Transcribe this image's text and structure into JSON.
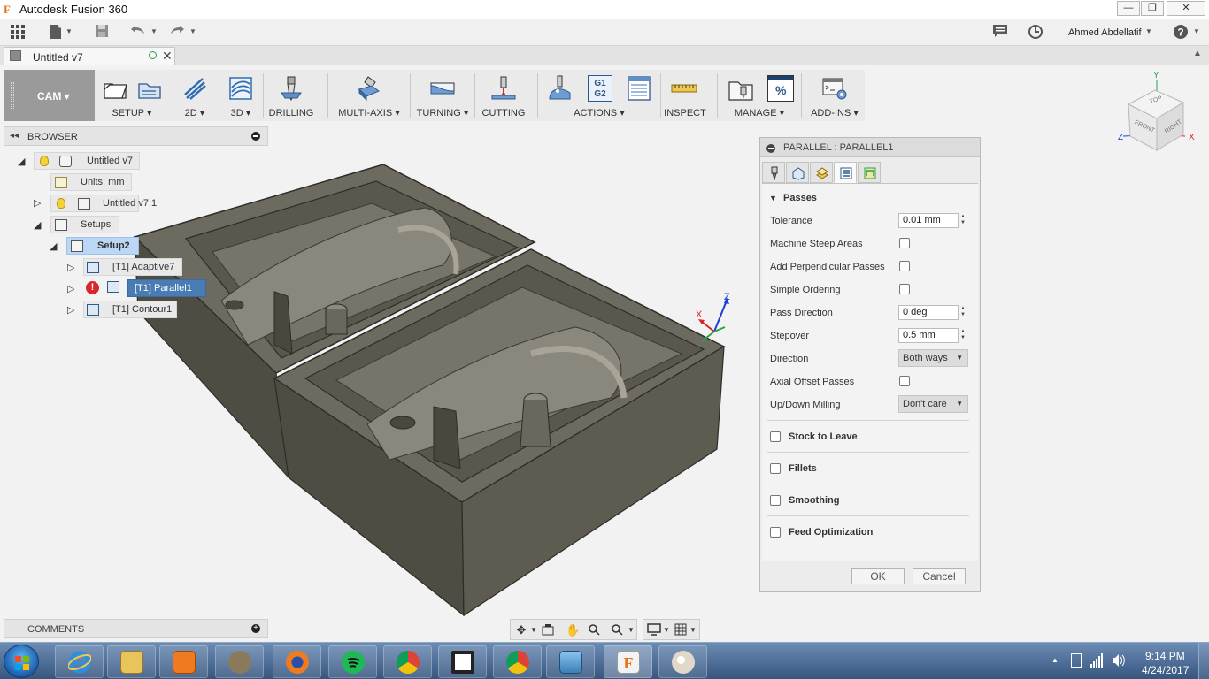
{
  "window": {
    "title": "Autodesk Fusion 360",
    "logo_letter": "F",
    "minimize": "—",
    "maximize": "❐",
    "close": "✕"
  },
  "quick_access": {
    "user_name": "Ahmed Abdellatif",
    "user_caret": "▼",
    "help_caret": "▼"
  },
  "document_tab": {
    "label": "Untitled v7",
    "close": "✕",
    "scroll_up": "▲"
  },
  "ribbon": {
    "workspace": "CAM ▾",
    "groups": [
      {
        "label": "SETUP ▾"
      },
      {
        "label": "2D ▾"
      },
      {
        "label": "3D ▾"
      },
      {
        "label": "DRILLING"
      },
      {
        "label": "MULTI-AXIS ▾"
      },
      {
        "label": "TURNING ▾"
      },
      {
        "label": "CUTTING"
      },
      {
        "label": "ACTIONS ▾"
      },
      {
        "label": "INSPECT"
      },
      {
        "label": "MANAGE ▾"
      },
      {
        "label": "ADD-INS ▾"
      }
    ],
    "gcode_line1": "G1",
    "gcode_line2": "G2",
    "percent": "%"
  },
  "browser": {
    "title": "BROWSER",
    "arrows": "◂◂",
    "nodes": {
      "root": "Untitled v7",
      "units": "Units: mm",
      "component": "Untitled v7:1",
      "setups": "Setups",
      "setup2": "Setup2",
      "adaptive": "[T1] Adaptive7",
      "parallel": "[T1] Parallel1",
      "contour": "[T1] Contour1"
    },
    "toggle_expanded": "◢",
    "toggle_collapsed": "▷",
    "error_mark": "!"
  },
  "comments": {
    "title": "COMMENTS",
    "plus": "+"
  },
  "viewcube": {
    "top": "TOP",
    "front": "FRONT",
    "right": "RIGHT",
    "axis_y": "Y",
    "axis_z": "Z",
    "axis_x": "X"
  },
  "triad": {
    "x": "X",
    "z": "Z"
  },
  "dialog": {
    "title": "PARALLEL : PARALLEL1",
    "passes_section": "Passes",
    "collapse_arrow": "▼",
    "fields": {
      "tolerance_label": "Tolerance",
      "tolerance_value": "0.01 mm",
      "steep_label": "Machine Steep Areas",
      "perp_label": "Add Perpendicular Passes",
      "ordering_label": "Simple Ordering",
      "pass_dir_label": "Pass Direction",
      "pass_dir_value": "0 deg",
      "stepover_label": "Stepover",
      "stepover_value": "0.5 mm",
      "direction_label": "Direction",
      "direction_value": "Both ways",
      "axial_label": "Axial Offset Passes",
      "updown_label": "Up/Down Milling",
      "updown_value": "Don't care"
    },
    "spinner": "▲\n▼",
    "caret": "▼",
    "sections": {
      "stock": "Stock to Leave",
      "fillets": "Fillets",
      "smoothing": "Smoothing",
      "feed": "Feed Optimization"
    },
    "ok": "OK",
    "cancel": "Cancel"
  },
  "taskbar": {
    "time": "9:14 PM",
    "date": "4/24/2017",
    "tray_arrow": "▲"
  },
  "colors": {
    "model_top": "#6a675c",
    "model_side": "#4f4c43",
    "selection": "#4a7cb4",
    "highlight": "#bcd7f5",
    "error": "#d8262a"
  }
}
